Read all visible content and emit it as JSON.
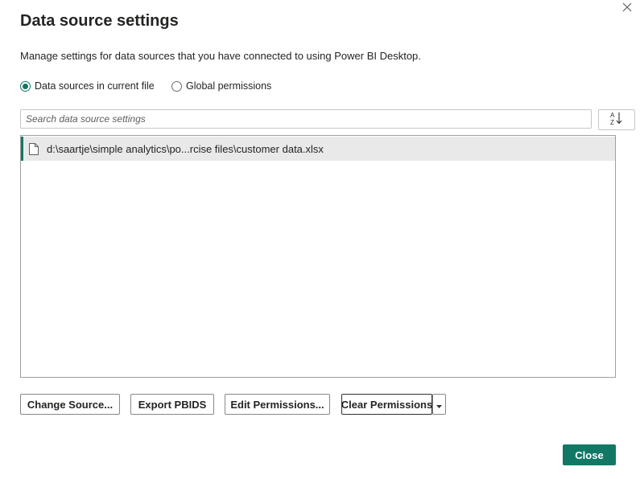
{
  "dialog": {
    "title": "Data source settings",
    "subtitle": "Manage settings for data sources that you have connected to using Power BI Desktop."
  },
  "scope": {
    "options": [
      {
        "label": "Data sources in current file",
        "selected": true
      },
      {
        "label": "Global permissions",
        "selected": false
      }
    ]
  },
  "search": {
    "placeholder": "Search data source settings",
    "value": ""
  },
  "sort": {
    "icon": "sort-az-icon"
  },
  "sources": [
    {
      "icon": "file-icon",
      "path": "d:\\saartje\\simple analytics\\po...rcise files\\customer data.xlsx",
      "selected": true
    }
  ],
  "actions": {
    "change_source": "Change Source...",
    "export_pbids": "Export PBIDS",
    "edit_permissions": "Edit Permissions...",
    "clear_permissions": "Clear Permissions"
  },
  "footer": {
    "close": "Close"
  },
  "colors": {
    "accent": "#117865",
    "selected_row": "#e9e9e9",
    "border": "#a19f9d"
  }
}
